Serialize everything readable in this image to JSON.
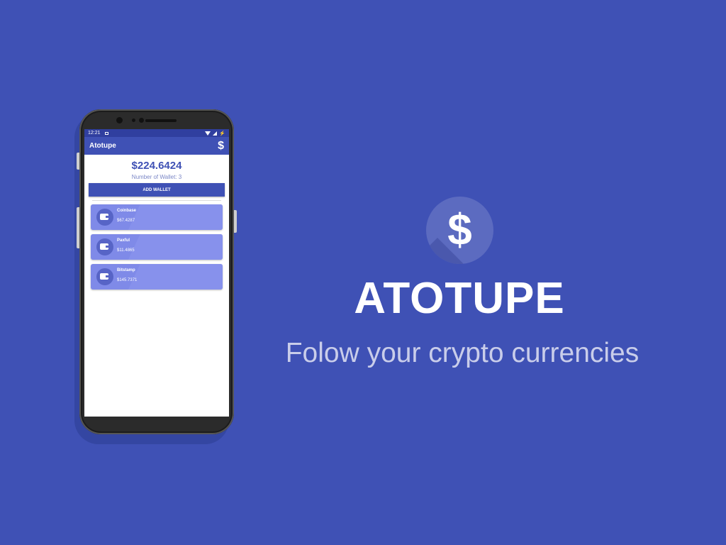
{
  "phone": {
    "status_bar": {
      "time": "12:21"
    },
    "app_bar": {
      "title": "Atotupe",
      "icon": "dollar-icon",
      "icon_glyph": "$"
    },
    "summary": {
      "total": "$224.6424",
      "wallet_count": "Number of Wallet: 3"
    },
    "add_button": {
      "label": "ADD WALLET"
    },
    "wallets": [
      {
        "name": "Coinbase",
        "amount": "$67.4287",
        "icon": "wallet-icon"
      },
      {
        "name": "Paxful",
        "amount": "$11.4865",
        "icon": "wallet-icon"
      },
      {
        "name": "Bitstamp",
        "amount": "$145.7371",
        "icon": "wallet-icon"
      }
    ]
  },
  "brand": {
    "logo_glyph": "$",
    "logo_icon": "dollar-icon",
    "title": "ATOTUPE",
    "tagline": "Folow your crypto currencies"
  },
  "colors": {
    "background": "#3f51b5",
    "status_bar": "#303f9f",
    "card": "#7f8ae8",
    "logo_circle": "#5c6bc0",
    "tagline": "#c9cdea"
  }
}
